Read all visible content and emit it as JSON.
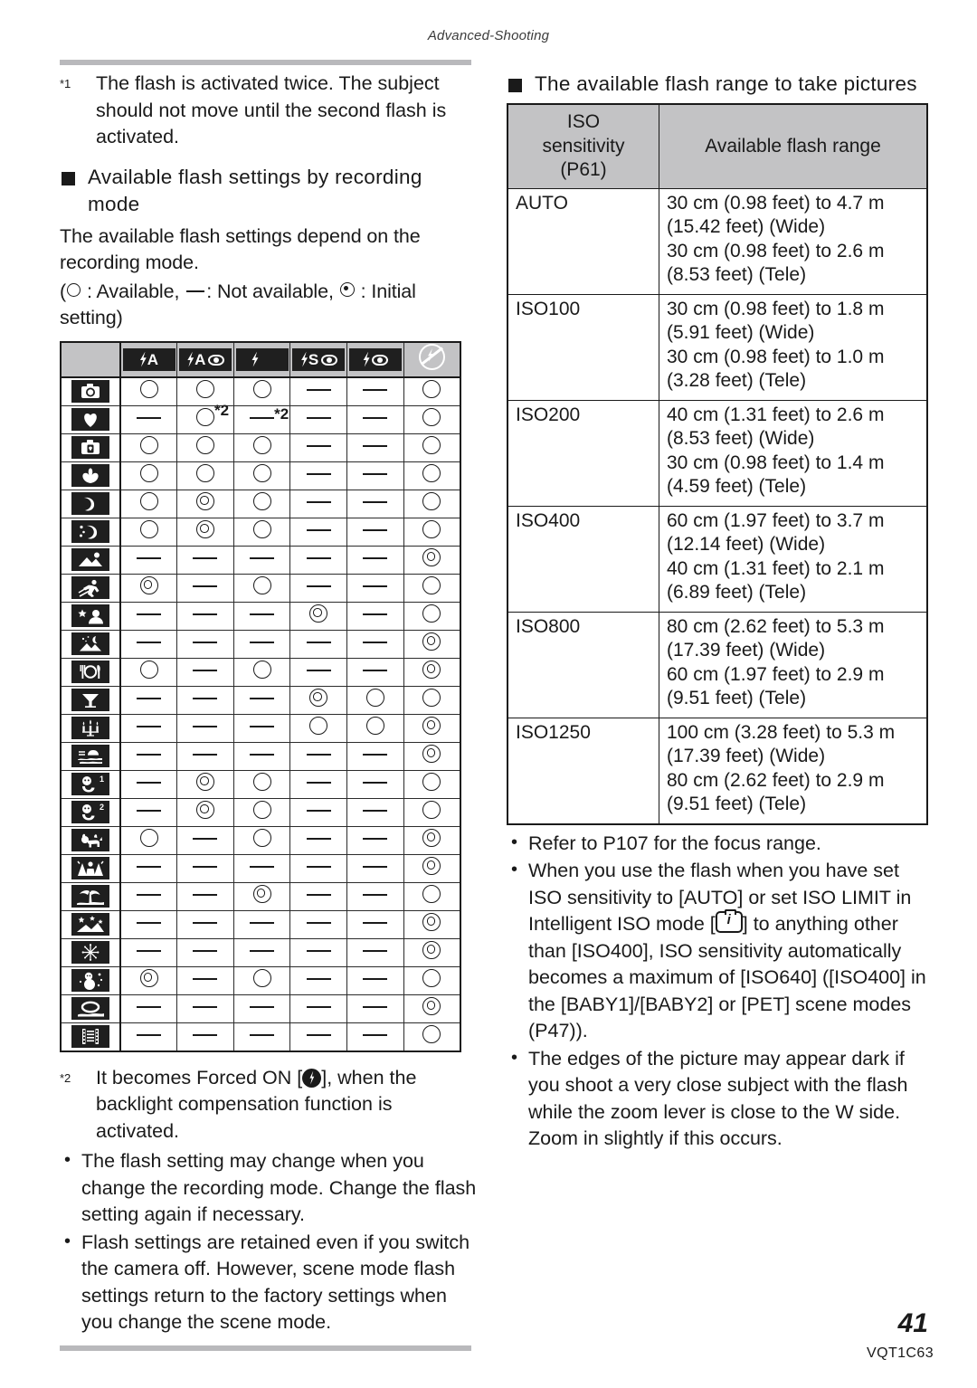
{
  "header": {
    "running_head": "Advanced-Shooting"
  },
  "footer": {
    "page_number": "41",
    "document_code": "VQT1C63"
  },
  "left_column": {
    "note_1": {
      "marker": "*1",
      "text": "The flash is activated twice. The subject should not move until the second flash is activated."
    },
    "section_heading": "Available flash settings by recording mode",
    "intro_paragraph": "The available flash settings depend on the recording mode.",
    "legend_prefix": "(",
    "legend_available": ": Available,",
    "legend_not_available": ": Not available,",
    "legend_initial": ": Initial setting)",
    "note_2": {
      "marker": "*2",
      "text_before": "It becomes Forced ON [",
      "text_after": "], when the backlight compensation function is activated."
    },
    "bullets": [
      "The flash setting may change when you change the recording mode. Change the flash setting again if necessary.",
      "Flash settings are retained even if you switch the camera off. However, scene mode flash settings return to the factory settings when you change the scene mode."
    ]
  },
  "matrix_table": {
    "columns": [
      {
        "id": "mode",
        "label": ""
      },
      {
        "id": "auto",
        "label": "flash-auto-icon",
        "glyph": "bolt+A"
      },
      {
        "id": "auto_redeye",
        "label": "flash-auto-redeye-icon",
        "glyph": "bolt+A+eye"
      },
      {
        "id": "forced_on",
        "label": "flash-forced-on-icon",
        "glyph": "bolt"
      },
      {
        "id": "slow_sync_redeye",
        "label": "flash-slow-sync-redeye-icon",
        "glyph": "bolt+S+eye"
      },
      {
        "id": "forced_on_redeye",
        "label": "flash-forced-on-redeye-icon",
        "glyph": "bolt+eye"
      },
      {
        "id": "forced_off",
        "label": "flash-off-icon",
        "glyph": "no-flash"
      }
    ],
    "rows": [
      {
        "mode": "normal-picture-mode-icon",
        "cells": [
          "o",
          "o",
          "o",
          "dash",
          "dash",
          "o"
        ]
      },
      {
        "mode": "portrait-mode-icon",
        "cells": [
          "dash",
          "o*2",
          "dash*2",
          "dash",
          "dash",
          "o"
        ]
      },
      {
        "mode": "soft-skin-mode-icon",
        "cells": [
          "o",
          "o",
          "o",
          "dash",
          "dash",
          "o"
        ]
      },
      {
        "mode": "macro-mode-icon",
        "cells": [
          "o",
          "o",
          "o",
          "dash",
          "dash",
          "o"
        ]
      },
      {
        "mode": "portrait-night-mode-icon",
        "cells": [
          "o",
          "dbl",
          "o",
          "dash",
          "dash",
          "o"
        ]
      },
      {
        "mode": "self-portrait-mode-icon",
        "cells": [
          "o",
          "dbl",
          "o",
          "dash",
          "dash",
          "o"
        ]
      },
      {
        "mode": "scenery-mode-icon",
        "cells": [
          "dash",
          "dash",
          "dash",
          "dash",
          "dash",
          "dbl"
        ]
      },
      {
        "mode": "sports-mode-icon",
        "cells": [
          "dbl",
          "dash",
          "o",
          "dash",
          "dash",
          "o"
        ]
      },
      {
        "mode": "night-portrait-mode-icon",
        "cells": [
          "dash",
          "dash",
          "dash",
          "dbl",
          "dash",
          "o"
        ]
      },
      {
        "mode": "night-scenery-mode-icon",
        "cells": [
          "dash",
          "dash",
          "dash",
          "dash",
          "dash",
          "dbl"
        ]
      },
      {
        "mode": "food-mode-icon",
        "cells": [
          "o",
          "dash",
          "o",
          "dash",
          "dash",
          "dbl"
        ]
      },
      {
        "mode": "party-mode-icon",
        "cells": [
          "dash",
          "dash",
          "dash",
          "dbl",
          "o",
          "o"
        ]
      },
      {
        "mode": "candle-light-mode-icon",
        "cells": [
          "dash",
          "dash",
          "dash",
          "o",
          "o",
          "dbl"
        ]
      },
      {
        "mode": "sunset-mode-icon",
        "cells": [
          "dash",
          "dash",
          "dash",
          "dash",
          "dash",
          "dbl"
        ]
      },
      {
        "mode": "baby1-mode-icon",
        "cells": [
          "dash",
          "dbl",
          "o",
          "dash",
          "dash",
          "o"
        ]
      },
      {
        "mode": "baby2-mode-icon",
        "cells": [
          "dash",
          "dbl",
          "o",
          "dash",
          "dash",
          "o"
        ]
      },
      {
        "mode": "pet-mode-icon",
        "cells": [
          "o",
          "dash",
          "o",
          "dash",
          "dash",
          "dbl"
        ]
      },
      {
        "mode": "high-sensitivity-mode-icon",
        "cells": [
          "dash",
          "dash",
          "dash",
          "dash",
          "dash",
          "dbl"
        ]
      },
      {
        "mode": "beach-mode-icon",
        "cells": [
          "dash",
          "dash",
          "dbl",
          "dash",
          "dash",
          "o"
        ]
      },
      {
        "mode": "starry-sky-mode-icon",
        "cells": [
          "dash",
          "dash",
          "dash",
          "dash",
          "dash",
          "dbl"
        ]
      },
      {
        "mode": "fireworks-mode-icon",
        "cells": [
          "dash",
          "dash",
          "dash",
          "dash",
          "dash",
          "dbl"
        ]
      },
      {
        "mode": "snow-mode-icon",
        "cells": [
          "dbl",
          "dash",
          "o",
          "dash",
          "dash",
          "o"
        ]
      },
      {
        "mode": "aerial-photo-mode-icon",
        "cells": [
          "dash",
          "dash",
          "dash",
          "dash",
          "dash",
          "dbl"
        ]
      },
      {
        "mode": "motion-picture-mode-icon",
        "cells": [
          "dash",
          "dash",
          "dash",
          "dash",
          "dash",
          "o"
        ]
      }
    ]
  },
  "right_column": {
    "section_heading": "The available flash range to take pictures",
    "iso_table": {
      "headers": [
        "ISO sensitivity (P61)",
        "Available flash range"
      ],
      "header_col1_lines": [
        "ISO",
        "sensitivity",
        "(P61)"
      ],
      "rows": [
        {
          "iso": "AUTO",
          "lines": [
            "30 cm (0.98 feet) to 4.7 m",
            "(15.42 feet) (Wide)",
            "30 cm (0.98 feet) to 2.6 m",
            "(8.53 feet) (Tele)"
          ]
        },
        {
          "iso": "ISO100",
          "lines": [
            "30 cm (0.98 feet) to 1.8 m",
            "(5.91 feet) (Wide)",
            "30 cm (0.98 feet) to 1.0 m",
            "(3.28 feet) (Tele)"
          ]
        },
        {
          "iso": "ISO200",
          "lines": [
            "40 cm (1.31 feet) to 2.6 m",
            "(8.53 feet) (Wide)",
            "30 cm (0.98 feet) to 1.4 m",
            "(4.59 feet) (Tele)"
          ]
        },
        {
          "iso": "ISO400",
          "lines": [
            "60 cm (1.97 feet) to 3.7 m",
            "(12.14 feet) (Wide)",
            "40 cm (1.31 feet) to 2.1 m",
            "(6.89 feet) (Tele)"
          ]
        },
        {
          "iso": "ISO800",
          "lines": [
            "80 cm (2.62 feet) to 5.3 m",
            "(17.39 feet) (Wide)",
            "60 cm (1.97 feet) to 2.9 m",
            "(9.51 feet) (Tele)"
          ]
        },
        {
          "iso": "ISO1250",
          "lines": [
            "100 cm (3.28 feet) to 5.3 m",
            "(17.39 feet) (Wide)",
            "80 cm (2.62 feet) to 2.9 m",
            "(9.51 feet) (Tele)"
          ]
        }
      ]
    },
    "bullets": {
      "b1": "Refer to P107 for the focus range.",
      "b2_before": "When you use the flash when you have set ISO sensitivity to [AUTO] or set ISO LIMIT in Intelligent ISO mode [",
      "b2_after": "] to anything other than [ISO400], ISO sensitivity automatically becomes a maximum of [ISO640] ([ISO400] in the [BABY1]/[BABY2] or [PET] scene modes (P47)).",
      "b3": "The edges of the picture may appear dark if you shoot a very close subject with the flash while the zoom lever is close to the W side. Zoom in slightly if this occurs."
    }
  },
  "colors": {
    "rule": "#b9b9bc",
    "table_header_bg": "#c3c3c5",
    "ink": "#1a1a1a"
  }
}
